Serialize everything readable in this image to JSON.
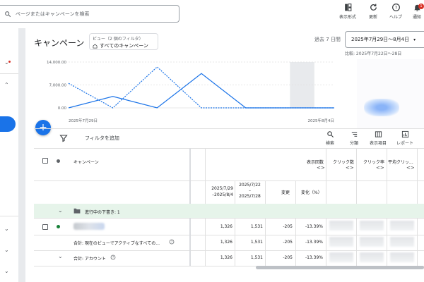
{
  "header": {
    "search_placeholder": "ページまたはキャンペーンを検索",
    "icons": [
      {
        "name": "view-format",
        "label": "表示形式"
      },
      {
        "name": "refresh",
        "label": "更新"
      },
      {
        "name": "help",
        "label": "ヘルプ"
      },
      {
        "name": "notifications",
        "label": "通知",
        "badge": "1"
      }
    ]
  },
  "page": {
    "title": "キャンペーン",
    "view_label": "ビュー（2 個のフィルタ）",
    "view_value": "すべてのキャンペーン",
    "period_label": "過去 7 日間",
    "date_range": "2025年7月29日～8月4日",
    "compare_label": "比較: 2025年7月22日～28日"
  },
  "chart_data": {
    "type": "line",
    "x_start_label": "2025年7月29日",
    "x_end_label": "2025年8月4日",
    "y_ticks": [
      "14,000.00",
      "7,000.00",
      "0.00"
    ],
    "ylim": [
      0,
      14000
    ],
    "points_count": 7,
    "series": [
      {
        "style": "solid",
        "values": [
          0,
          3500,
          0,
          10500,
          0,
          0,
          0
        ]
      },
      {
        "style": "dashed",
        "values": [
          7500,
          0,
          12500,
          0,
          0,
          0,
          0
        ]
      }
    ],
    "highlight_index": 5,
    "colors": {
      "line": "#1a73e8",
      "highlight": "#e8eaed"
    }
  },
  "toolbar": {
    "add_filter": "フィルタを追加",
    "tools": [
      {
        "icon": "search-icon",
        "label": "検索"
      },
      {
        "icon": "segment-icon",
        "label": "分類"
      },
      {
        "icon": "columns-icon",
        "label": "表示項目"
      },
      {
        "icon": "report-icon",
        "label": "レポート"
      }
    ]
  },
  "table": {
    "col_campaign": "キャンペーン",
    "col_impressions": "表示回数",
    "col_clicks": "クリック数",
    "col_ctr": "クリック率",
    "col_avg_cpc": "平均クリッ...",
    "sort_glyph": "<>",
    "sub_current": "2025/7/29\n–2025/8/4",
    "sub_prev": "2025/7/22\n–\n2025/7/28",
    "sub_change": "変更",
    "sub_change_pct": "変化（%）",
    "group_label": "進行中の下書き: 1",
    "rows": [
      {
        "name": "",
        "current": "1,326",
        "prev": "1,531",
        "change": "-205",
        "pct": "-13.39%"
      },
      {
        "name": "合計: 現在のビューでアクティブなすべての...",
        "current": "1,326",
        "prev": "1,531",
        "change": "-205",
        "pct": "-13.39%"
      },
      {
        "name": "合計: アカウント",
        "current": "1,326",
        "prev": "1,531",
        "change": "-205",
        "pct": "-13.39%"
      }
    ],
    "status_color": "#188038"
  }
}
